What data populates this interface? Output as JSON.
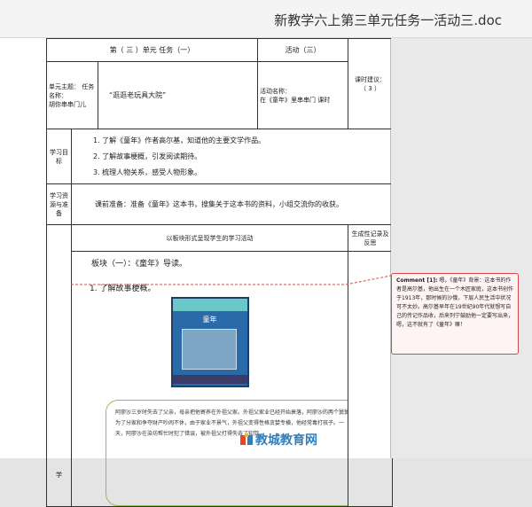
{
  "window": {
    "title": "新教学六上第三单元任务一活动三.doc"
  },
  "table": {
    "header_left": "第（ 三 ）单元 任务（一）",
    "header_mid": "活动（三）",
    "class_hours_label": "课时建议：",
    "class_hours_value": "（ 3 ）",
    "unit_theme_label": "单元主题： 任务名称：",
    "unit_theme_value": "胡你串串门儿",
    "task_name": "“逛逛老玩具大院”",
    "activity_name_label": "活动名称：",
    "activity_name_value": "在《童年》里串串门 课时",
    "goals_label": "学习目标",
    "goals": [
      "1. 了解《童年》作者高尔基，知道他的主要文学作品。",
      "2. 了解故事梗概，引发阅读期待。",
      "3. 梳理人物关系，感受人物形象。"
    ],
    "resources_label": "学习资源与准备",
    "resources_text": "课前准备：准备《童年》这本书，搜集关于这本书的资料，小组交流你的收获。",
    "activity_head": "以板块形式呈现学生的学习活动",
    "record_head": "生成性记录及反思",
    "learn_label": "学",
    "section1": "板块（一）：《童年》导读。",
    "task1": "1. 了解故事梗概。",
    "cover_name": "童年",
    "story": "阿廖沙三岁时失去了父亲，母亲把他寄养在外祖父家。外祖父家业已经开始衰落，阿廖沙的两个舅舅为了分家和争夺财产吵闹不休，由于家业不景气，外祖父变得性格贪婪专横，他经常毒打孩子。一天，阿廖沙在染坊帮忙时犯了错误，被外祖父打得失去了知觉。"
  },
  "comment": {
    "label": "Comment [1]:",
    "text": "嗯，《童年》背景：这本书的作者是高尔基，他出生在一个木匠家庭，这本书创作于1913年，那时候的沙俄，下层人民生活中状况可不太妙。高尔基早年在19世纪90年代就想写自己的传记作品收，后来列宁鼓励他一定要写出来，嗯，这不就有了《童年》嘛！"
  },
  "watermark": {
    "text": "教城教育网"
  },
  "colors": {
    "comment_border": "#d94848",
    "story_border": "#8fbc5a",
    "cover_blue": "#2b6aa8"
  }
}
